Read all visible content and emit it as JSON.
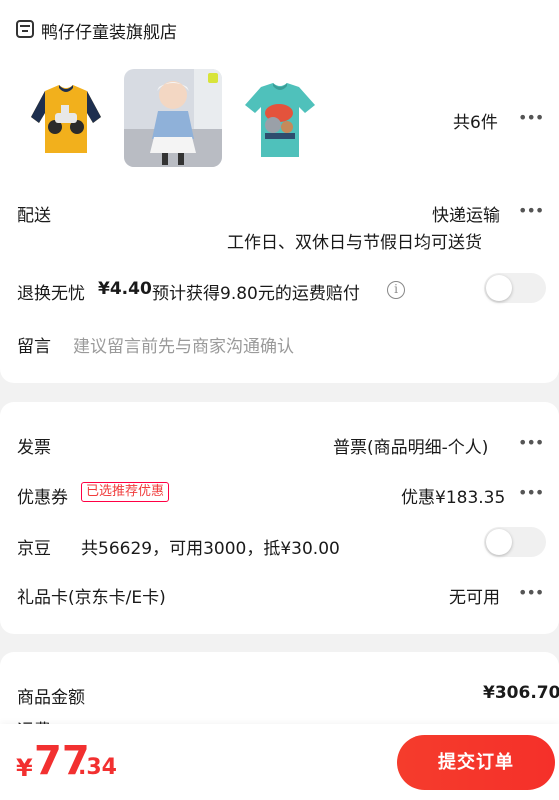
{
  "store": {
    "name": "鸭仔仔童装旗舰店"
  },
  "products": {
    "count_text": "共6件"
  },
  "delivery": {
    "label": "配送",
    "method": "快递运输",
    "note": "工作日、双休日与节假日均可送货"
  },
  "return_insurance": {
    "label": "退换无忧",
    "price": "¥4.40",
    "desc": "预计获得9.80元的运费赔付",
    "enabled": false
  },
  "message": {
    "label": "留言",
    "placeholder": "建议留言前先与商家沟通确认"
  },
  "invoice": {
    "label": "发票",
    "value": "普票(商品明细-个人)"
  },
  "coupon": {
    "label": "优惠券",
    "tag": "已选推荐优惠",
    "value": "优惠¥183.35"
  },
  "jd_beans": {
    "label": "京豆",
    "desc": "共56629，可用3000，抵¥30.00",
    "enabled": false
  },
  "gift_card": {
    "label": "礼品卡(京东卡/E卡)",
    "value": "无可用"
  },
  "summary": {
    "goods_label": "商品金额",
    "goods_value": "¥306.70",
    "shipping_label": "运费"
  },
  "footer": {
    "currency": "¥",
    "total_int": "77",
    "total_dec": ".34",
    "submit_label": "提交订单"
  },
  "colors": {
    "accent": "#f23030",
    "background": "#f2f2f2"
  }
}
